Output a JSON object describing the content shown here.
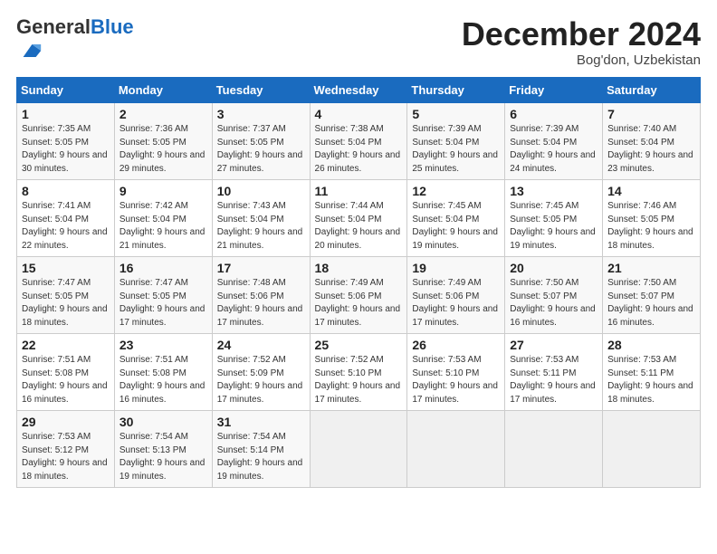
{
  "header": {
    "logo_general": "General",
    "logo_blue": "Blue",
    "month_title": "December 2024",
    "location": "Bog'don, Uzbekistan"
  },
  "weekdays": [
    "Sunday",
    "Monday",
    "Tuesday",
    "Wednesday",
    "Thursday",
    "Friday",
    "Saturday"
  ],
  "weeks": [
    [
      {
        "day": "1",
        "sunrise": "7:35 AM",
        "sunset": "5:05 PM",
        "daylight": "9 hours and 30 minutes."
      },
      {
        "day": "2",
        "sunrise": "7:36 AM",
        "sunset": "5:05 PM",
        "daylight": "9 hours and 29 minutes."
      },
      {
        "day": "3",
        "sunrise": "7:37 AM",
        "sunset": "5:05 PM",
        "daylight": "9 hours and 27 minutes."
      },
      {
        "day": "4",
        "sunrise": "7:38 AM",
        "sunset": "5:04 PM",
        "daylight": "9 hours and 26 minutes."
      },
      {
        "day": "5",
        "sunrise": "7:39 AM",
        "sunset": "5:04 PM",
        "daylight": "9 hours and 25 minutes."
      },
      {
        "day": "6",
        "sunrise": "7:39 AM",
        "sunset": "5:04 PM",
        "daylight": "9 hours and 24 minutes."
      },
      {
        "day": "7",
        "sunrise": "7:40 AM",
        "sunset": "5:04 PM",
        "daylight": "9 hours and 23 minutes."
      }
    ],
    [
      {
        "day": "8",
        "sunrise": "7:41 AM",
        "sunset": "5:04 PM",
        "daylight": "9 hours and 22 minutes."
      },
      {
        "day": "9",
        "sunrise": "7:42 AM",
        "sunset": "5:04 PM",
        "daylight": "9 hours and 21 minutes."
      },
      {
        "day": "10",
        "sunrise": "7:43 AM",
        "sunset": "5:04 PM",
        "daylight": "9 hours and 21 minutes."
      },
      {
        "day": "11",
        "sunrise": "7:44 AM",
        "sunset": "5:04 PM",
        "daylight": "9 hours and 20 minutes."
      },
      {
        "day": "12",
        "sunrise": "7:45 AM",
        "sunset": "5:04 PM",
        "daylight": "9 hours and 19 minutes."
      },
      {
        "day": "13",
        "sunrise": "7:45 AM",
        "sunset": "5:05 PM",
        "daylight": "9 hours and 19 minutes."
      },
      {
        "day": "14",
        "sunrise": "7:46 AM",
        "sunset": "5:05 PM",
        "daylight": "9 hours and 18 minutes."
      }
    ],
    [
      {
        "day": "15",
        "sunrise": "7:47 AM",
        "sunset": "5:05 PM",
        "daylight": "9 hours and 18 minutes."
      },
      {
        "day": "16",
        "sunrise": "7:47 AM",
        "sunset": "5:05 PM",
        "daylight": "9 hours and 17 minutes."
      },
      {
        "day": "17",
        "sunrise": "7:48 AM",
        "sunset": "5:06 PM",
        "daylight": "9 hours and 17 minutes."
      },
      {
        "day": "18",
        "sunrise": "7:49 AM",
        "sunset": "5:06 PM",
        "daylight": "9 hours and 17 minutes."
      },
      {
        "day": "19",
        "sunrise": "7:49 AM",
        "sunset": "5:06 PM",
        "daylight": "9 hours and 17 minutes."
      },
      {
        "day": "20",
        "sunrise": "7:50 AM",
        "sunset": "5:07 PM",
        "daylight": "9 hours and 16 minutes."
      },
      {
        "day": "21",
        "sunrise": "7:50 AM",
        "sunset": "5:07 PM",
        "daylight": "9 hours and 16 minutes."
      }
    ],
    [
      {
        "day": "22",
        "sunrise": "7:51 AM",
        "sunset": "5:08 PM",
        "daylight": "9 hours and 16 minutes."
      },
      {
        "day": "23",
        "sunrise": "7:51 AM",
        "sunset": "5:08 PM",
        "daylight": "9 hours and 16 minutes."
      },
      {
        "day": "24",
        "sunrise": "7:52 AM",
        "sunset": "5:09 PM",
        "daylight": "9 hours and 17 minutes."
      },
      {
        "day": "25",
        "sunrise": "7:52 AM",
        "sunset": "5:10 PM",
        "daylight": "9 hours and 17 minutes."
      },
      {
        "day": "26",
        "sunrise": "7:53 AM",
        "sunset": "5:10 PM",
        "daylight": "9 hours and 17 minutes."
      },
      {
        "day": "27",
        "sunrise": "7:53 AM",
        "sunset": "5:11 PM",
        "daylight": "9 hours and 17 minutes."
      },
      {
        "day": "28",
        "sunrise": "7:53 AM",
        "sunset": "5:11 PM",
        "daylight": "9 hours and 18 minutes."
      }
    ],
    [
      {
        "day": "29",
        "sunrise": "7:53 AM",
        "sunset": "5:12 PM",
        "daylight": "9 hours and 18 minutes."
      },
      {
        "day": "30",
        "sunrise": "7:54 AM",
        "sunset": "5:13 PM",
        "daylight": "9 hours and 19 minutes."
      },
      {
        "day": "31",
        "sunrise": "7:54 AM",
        "sunset": "5:14 PM",
        "daylight": "9 hours and 19 minutes."
      },
      null,
      null,
      null,
      null
    ]
  ]
}
